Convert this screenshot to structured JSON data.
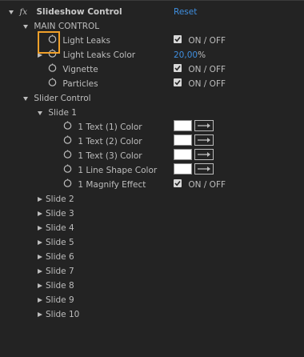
{
  "header": {
    "fx": "fx",
    "title": "Slideshow Control",
    "reset": "Reset"
  },
  "main_control": {
    "label": "MAIN CONTROL",
    "items": [
      {
        "label": "Light Leaks",
        "checkbox_label": "ON / OFF",
        "checked": true
      },
      {
        "label": "Light Leaks Color",
        "value": "20,00",
        "unit": "%"
      },
      {
        "label": "Vignette",
        "checkbox_label": "ON / OFF",
        "checked": true
      },
      {
        "label": "Particles",
        "checkbox_label": "ON / OFF",
        "checked": true
      }
    ]
  },
  "slider_control": {
    "label": "Slider Control",
    "slide1": {
      "label": "Slide 1",
      "items": [
        {
          "label": "1 Text (1) Color",
          "color": "#ffffff"
        },
        {
          "label": "1 Text (2) Color",
          "color": "#ffffff"
        },
        {
          "label": "1 Text (3) Color",
          "color": "#ffffff"
        },
        {
          "label": "1 Line Shape Color",
          "color": "#ffffff"
        },
        {
          "label": "1 Magnify Effect",
          "checkbox_label": "ON / OFF",
          "checked": true
        }
      ]
    },
    "other_slides": [
      "Slide 2",
      "Slide 3",
      "Slide 4",
      "Slide 5",
      "Slide 6",
      "Slide 7",
      "Slide 8",
      "Slide 9",
      "Slide 10"
    ]
  },
  "colors": {
    "background": "#232323",
    "text": "#bdbdbd",
    "accent_blue": "#3f8fe0",
    "highlight_orange": "#f0a02a"
  }
}
